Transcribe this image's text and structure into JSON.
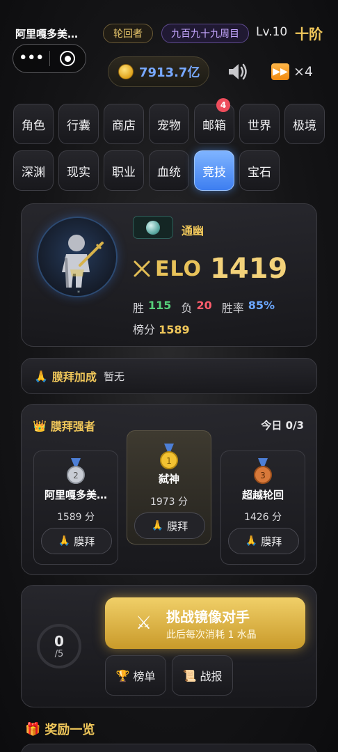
{
  "header": {
    "player_name": "阿里嘎多美…",
    "class_tag": "轮回者",
    "cycle_tag": "九百九十九周目",
    "level": "Lv.10",
    "tier": "十阶",
    "gold": "7913.7亿",
    "speed": "×4",
    "capsule_more": "•••"
  },
  "tabs_row1": [
    {
      "label": "角色"
    },
    {
      "label": "行囊"
    },
    {
      "label": "商店"
    },
    {
      "label": "宠物"
    },
    {
      "label": "邮箱",
      "badge": "4"
    },
    {
      "label": "世界"
    },
    {
      "label": "极境"
    }
  ],
  "tabs_row2": [
    {
      "label": "深渊"
    },
    {
      "label": "现实"
    },
    {
      "label": "职业"
    },
    {
      "label": "血统"
    },
    {
      "label": "竞技",
      "active": true
    },
    {
      "label": "宝石"
    }
  ],
  "hero": {
    "title": "通幽",
    "elo_label": "ELO",
    "elo_value": "1419",
    "win_label": "胜",
    "wins": "115",
    "loss_label": "负",
    "losses": "20",
    "rate_label": "胜率",
    "win_rate": "85%",
    "rank_label": "榜分",
    "rank_score": "1589"
  },
  "blessing": {
    "title": "膜拜加成",
    "value": "暂无"
  },
  "worship": {
    "title": "膜拜强者",
    "today": "今日 0/3",
    "button_label": "膜拜",
    "cards": [
      {
        "name": "阿里嘎多美…",
        "score": "1589 分",
        "medal": "silver",
        "medal_num": "2"
      },
      {
        "name": "弑神",
        "score": "1973 分",
        "medal": "gold",
        "medal_num": "1"
      },
      {
        "name": "超越轮回",
        "score": "1426 分",
        "medal": "bronze",
        "medal_num": "3"
      }
    ]
  },
  "challenge": {
    "used": "0",
    "total": "/5",
    "button_title": "挑战镜像对手",
    "button_sub": "此后每次消耗 1 水晶",
    "leaderboard": "榜单",
    "battle_log": "战报"
  },
  "rewards": {
    "title": "奖励一览"
  },
  "colors": {
    "accent_gold": "#f0c75a",
    "active_tab": "#3d7ef0",
    "win": "#56d07a",
    "loss": "#ff5d6c",
    "rate": "#6ca8ff"
  }
}
